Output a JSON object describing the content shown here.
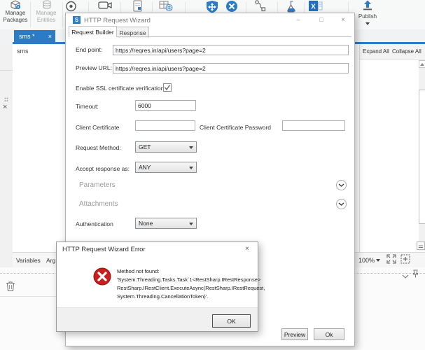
{
  "ribbon": {
    "manage_packages_line1": "Manage",
    "manage_packages_line2": "Packages",
    "manage_entities_line1": "Manage",
    "manage_entities_line2": "Entities",
    "publish_label": "Publish",
    "icons": [
      "record-icon",
      "camera-icon",
      "sequence-doc-icon",
      "data-scraping-icon",
      "shield-arrows-icon",
      "remove-circle-icon",
      "wiring-icon",
      "test-flask-icon",
      "excel-icon",
      "publish-upload-icon"
    ]
  },
  "tab_strip": {
    "active_tab": "sms *",
    "close_glyph": "×"
  },
  "left_strip": {
    "close_glyph": "×"
  },
  "canvas": {
    "breadcrumb": "sms"
  },
  "right_panel": {
    "expand_all": "Expand All",
    "collapse_all": "Collapse All"
  },
  "status_bar": {
    "variables_tab": "Variables",
    "arguments_tab": "Arg",
    "zoom_level": "100%"
  },
  "wizard": {
    "title": "HTTP Request Wizard",
    "icon_letter": "S",
    "minimize_glyph": "–",
    "maximize_glyph": "□",
    "close_glyph": "×",
    "tab_request_builder": "Request Builder",
    "tab_response": "Response",
    "endpoint_label": "End point:",
    "endpoint_value": "https://reqres.in/api/users?page=2",
    "preview_url_label": "Preview URL:",
    "preview_url_value": "https://reqres.in/api/users?page=2",
    "ssl_label": "Enable SSL certificate verification",
    "ssl_checked": true,
    "timeout_label": "Timeout:",
    "timeout_value": "6000",
    "client_certificate_label": "Client Certificate",
    "client_certificate_password_label": "Client Certificate Password",
    "client_certificate_value": "",
    "client_certificate_password_value": "",
    "request_method_label": "Request Method:",
    "request_method_value": "GET",
    "accept_response_label": "Accept response as:",
    "accept_response_value": "ANY",
    "parameters_section": "Parameters",
    "attachments_section": "Attachments",
    "authentication_label": "Authentication",
    "authentication_value": "None",
    "preview_button": "Preview",
    "ok_button": "Ok"
  },
  "error_dialog": {
    "title": "HTTP Request Wizard Error",
    "close_glyph": "×",
    "line1": "Method not found:",
    "line2": "'System.Threading.Tasks.Task`1<RestSharp.IRestResponse>",
    "line3": "RestSharp.IRestClient.ExecuteAsync(RestSharp.IRestRequest,",
    "line4": "System.Threading.CancellationToken)'.",
    "ok_button": "OK"
  },
  "colors": {
    "accent_blue": "#2b7bc7",
    "error_red": "#c81e1e"
  }
}
